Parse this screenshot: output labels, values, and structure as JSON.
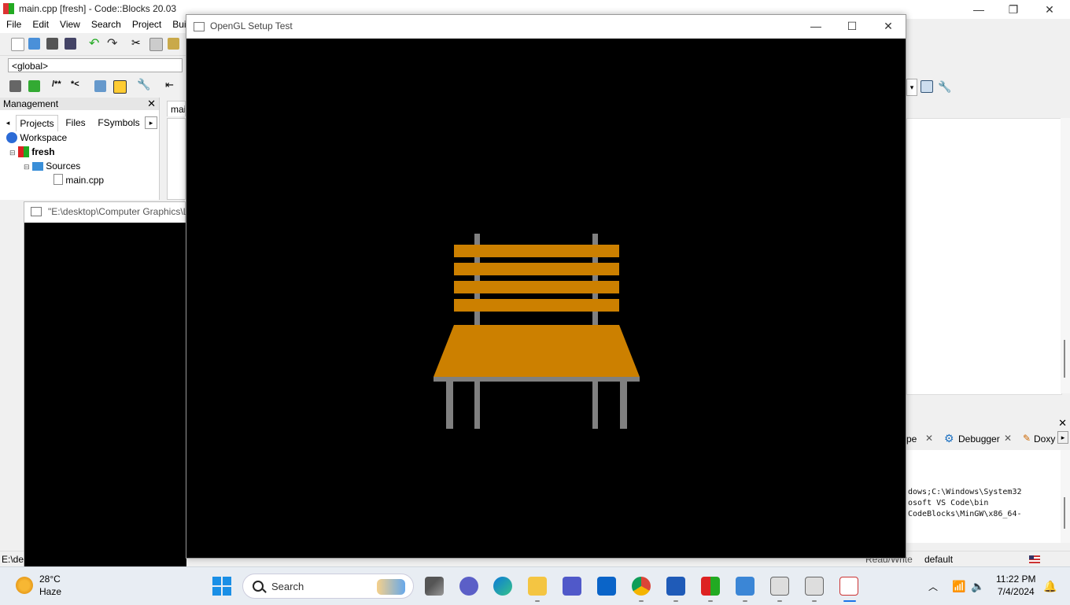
{
  "codeblocks": {
    "title": "main.cpp [fresh] - Code::Blocks 20.03",
    "menu": [
      "File",
      "Edit",
      "View",
      "Search",
      "Project",
      "Buil"
    ],
    "scope": "<global>",
    "management": {
      "title": "Management",
      "tabs": [
        "Projects",
        "Files",
        "FSymbols"
      ],
      "tree": {
        "workspace": "Workspace",
        "project": "fresh",
        "folder": "Sources",
        "file": "main.cpp"
      }
    },
    "editor_tab": "mai",
    "logs": {
      "tabs": [
        "pe",
        "Debugger",
        "Doxy"
      ],
      "lines": [
        "dows;C:\\Windows\\System32",
        "osoft VS Code\\bin",
        "CodeBlocks\\MinGW\\x86_64-"
      ]
    },
    "status": {
      "left": "E:\\de",
      "mode": "Read/Write",
      "encoding": "default"
    }
  },
  "console": {
    "title": "\"E:\\desktop\\Computer Graphics\\L"
  },
  "glwindow": {
    "title": "OpenGL Setup Test",
    "scene": {
      "background": "#000000",
      "wood_color": "#cc8000",
      "frame_color": "#808080",
      "back_slats": 4,
      "legs": 4
    }
  },
  "taskbar": {
    "weather": {
      "temp": "28°C",
      "desc": "Haze"
    },
    "search": "Search",
    "apps": [
      "task-view",
      "chat",
      "edge",
      "file-explorer",
      "teams",
      "outlook",
      "chrome",
      "word",
      "codeblocks",
      "notepad",
      "console",
      "console",
      "opengl"
    ],
    "clock": {
      "time": "11:22 PM",
      "date": "7/4/2024"
    }
  }
}
